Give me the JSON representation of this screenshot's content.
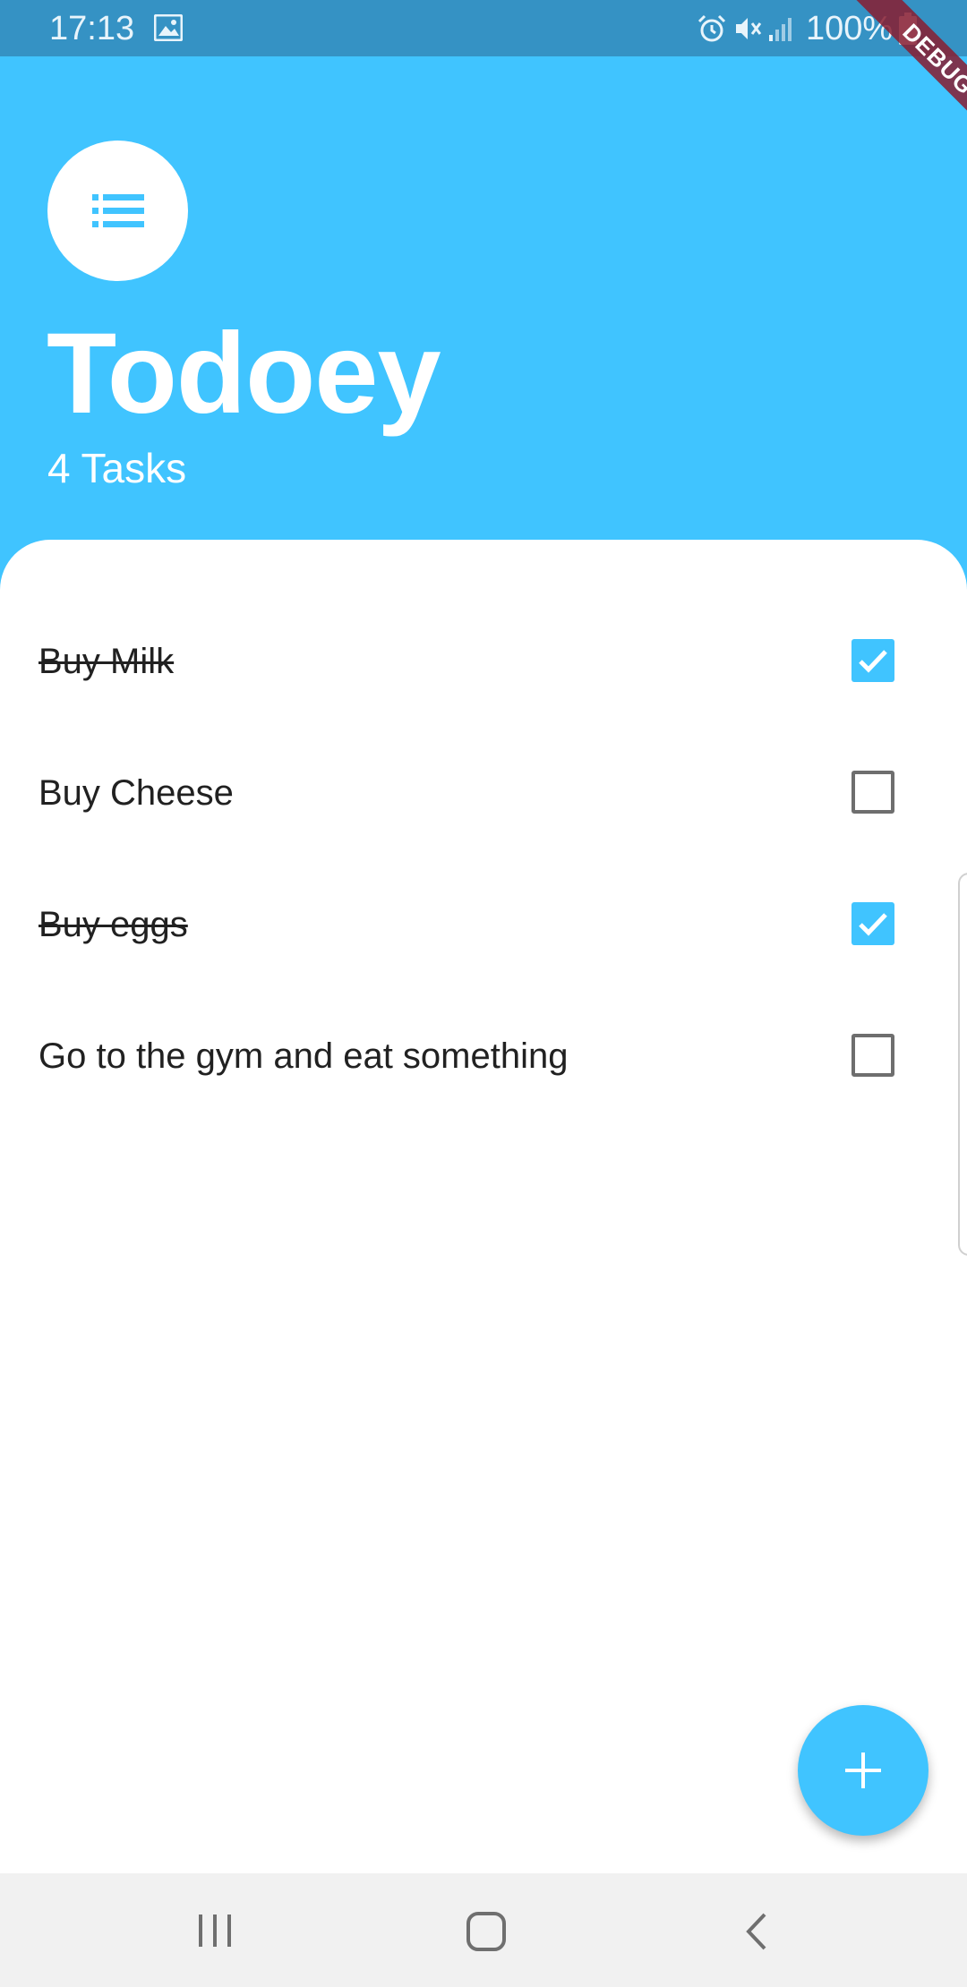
{
  "status_bar": {
    "time": "17:13",
    "battery_text": "100%",
    "icons": [
      "gallery-icon",
      "alarm-icon",
      "mute-icon",
      "signal-icon",
      "battery-icon"
    ]
  },
  "debug_banner": {
    "label": "DEBUG"
  },
  "header": {
    "title": "Todoey",
    "task_count": "4 Tasks",
    "icon": "list-icon"
  },
  "tasks": [
    {
      "label": "Buy Milk",
      "done": true
    },
    {
      "label": "Buy Cheese",
      "done": false
    },
    {
      "label": "Buy eggs",
      "done": true
    },
    {
      "label": "Go to the gym and eat something",
      "done": false
    }
  ],
  "fab": {
    "icon": "add-icon"
  },
  "nav_bar": {
    "icons": [
      "recent-apps-icon",
      "home-icon",
      "back-icon"
    ]
  },
  "colors": {
    "accent": "#40c4ff",
    "status_bar": "#3592c4",
    "debug": "#881c30"
  }
}
